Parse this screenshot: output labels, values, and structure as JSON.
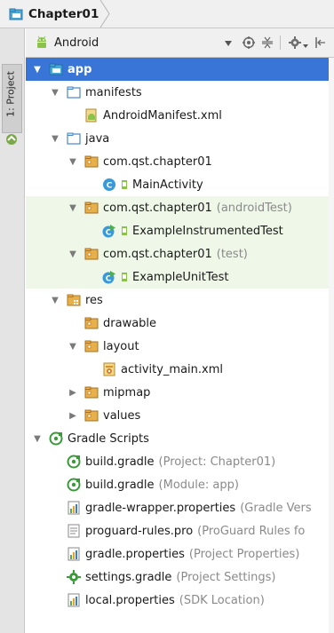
{
  "breadcrumb": {
    "project": "Chapter01"
  },
  "side_strip": {
    "tab_label": "1: Project"
  },
  "toolbar": {
    "view_mode": "Android"
  },
  "tree": [
    {
      "label": "app",
      "icon": "module-folder-icon",
      "indent": 0,
      "arrow": "down",
      "selected": true,
      "bold": true
    },
    {
      "label": "manifests",
      "icon": "folder-icon",
      "indent": 1,
      "arrow": "down"
    },
    {
      "label": "AndroidManifest.xml",
      "icon": "manifest-file-icon",
      "indent": 2,
      "arrow": "none"
    },
    {
      "label": "java",
      "icon": "folder-icon",
      "indent": 1,
      "arrow": "down"
    },
    {
      "label": "com.qst.chapter01",
      "icon": "package-icon",
      "indent": 2,
      "arrow": "down"
    },
    {
      "label": "MainActivity",
      "icon": "class-icon",
      "indent": 3,
      "arrow": "none"
    },
    {
      "label": "com.qst.chapter01",
      "suffix": "(androidTest)",
      "icon": "package-icon",
      "indent": 2,
      "arrow": "down",
      "tinted": true
    },
    {
      "label": "ExampleInstrumentedTest",
      "icon": "test-class-icon",
      "indent": 3,
      "arrow": "none",
      "tinted": true
    },
    {
      "label": "com.qst.chapter01",
      "suffix": "(test)",
      "icon": "package-icon",
      "indent": 2,
      "arrow": "down",
      "tinted": true
    },
    {
      "label": "ExampleUnitTest",
      "icon": "test-class-icon",
      "indent": 3,
      "arrow": "none",
      "tinted": true
    },
    {
      "label": "res",
      "icon": "res-folder-icon",
      "indent": 1,
      "arrow": "down"
    },
    {
      "label": "drawable",
      "icon": "package-icon",
      "indent": 2,
      "arrow": "none"
    },
    {
      "label": "layout",
      "icon": "package-icon",
      "indent": 2,
      "arrow": "down"
    },
    {
      "label": "activity_main.xml",
      "icon": "layout-file-icon",
      "indent": 3,
      "arrow": "none"
    },
    {
      "label": "mipmap",
      "icon": "package-icon",
      "indent": 2,
      "arrow": "right"
    },
    {
      "label": "values",
      "icon": "package-icon",
      "indent": 2,
      "arrow": "right"
    },
    {
      "label": "Gradle Scripts",
      "icon": "gradle-icon",
      "indent": 0,
      "arrow": "down"
    },
    {
      "label": "build.gradle",
      "suffix": "(Project: Chapter01)",
      "icon": "gradle-icon",
      "indent": 1,
      "arrow": "none"
    },
    {
      "label": "build.gradle",
      "suffix": "(Module: app)",
      "icon": "gradle-icon",
      "indent": 1,
      "arrow": "none"
    },
    {
      "label": "gradle-wrapper.properties",
      "suffix": "(Gradle Vers",
      "icon": "properties-icon",
      "indent": 1,
      "arrow": "none"
    },
    {
      "label": "proguard-rules.pro",
      "suffix": "(ProGuard Rules fo",
      "icon": "text-file-icon",
      "indent": 1,
      "arrow": "none"
    },
    {
      "label": "gradle.properties",
      "suffix": "(Project Properties)",
      "icon": "properties-icon",
      "indent": 1,
      "arrow": "none"
    },
    {
      "label": "settings.gradle",
      "suffix": "(Project Settings)",
      "icon": "settings-gradle-icon",
      "indent": 1,
      "arrow": "none"
    },
    {
      "label": "local.properties",
      "suffix": "(SDK Location)",
      "icon": "properties-icon",
      "indent": 1,
      "arrow": "none"
    }
  ],
  "colors": {
    "selection": "#3875d7",
    "test_tint": "#eef7e8",
    "package_folder": "#d8a34a",
    "android_green": "#8bc34a",
    "class_blue": "#3a9ad9"
  }
}
